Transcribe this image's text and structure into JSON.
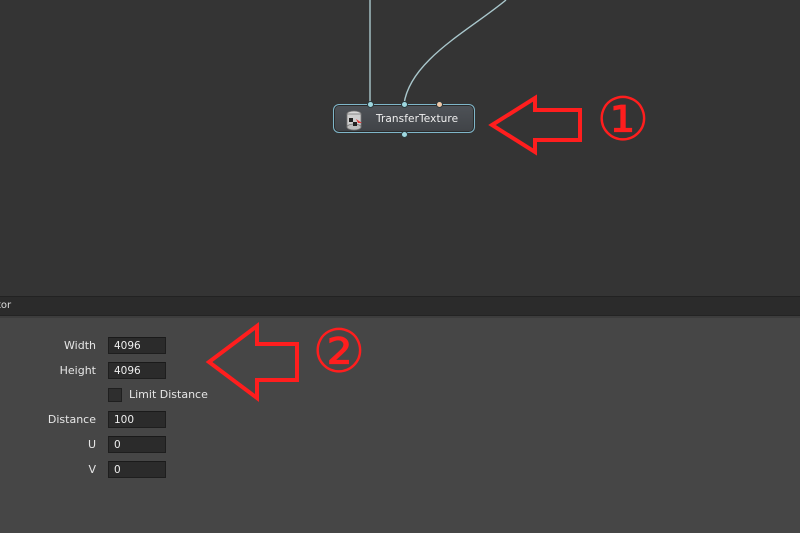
{
  "graph": {
    "node": {
      "label": "TransferTexture",
      "icon": "transfer-texture-icon"
    },
    "annotation_number": "①"
  },
  "attribute_panel": {
    "title": "tor",
    "annotation_number": "②",
    "fields": {
      "width": {
        "label": "Width",
        "value": "4096"
      },
      "height": {
        "label": "Height",
        "value": "4096"
      },
      "limit_distance": {
        "label": "Limit Distance",
        "checked": false
      },
      "distance": {
        "label": "Distance",
        "value": "100"
      },
      "u": {
        "label": "U",
        "value": "0"
      },
      "v": {
        "label": "V",
        "value": "0"
      }
    }
  },
  "colors": {
    "annotation_red": "#ff1e1e",
    "node_border": "#7fb6c9",
    "port_cyan": "#9fd8e0",
    "port_peach": "#f2c9a8"
  }
}
